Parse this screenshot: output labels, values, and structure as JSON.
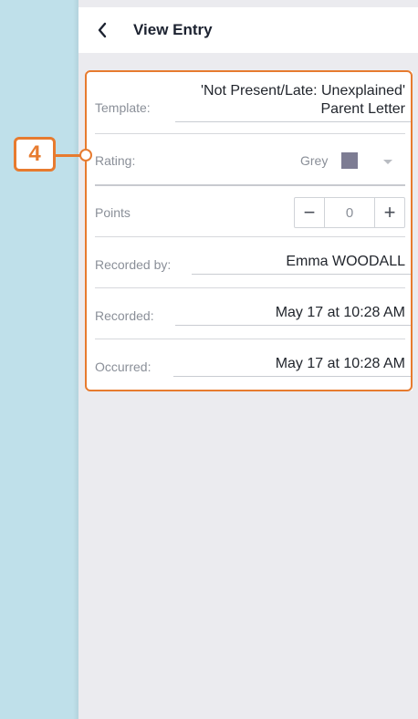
{
  "header": {
    "title": "View Entry",
    "back_icon": "chevron-left-icon"
  },
  "entry": {
    "template": {
      "label": "Template:",
      "value_line1": "'Not Present/Late: Unexplained'",
      "value_line2": "Parent Letter"
    },
    "rating": {
      "label": "Rating:",
      "value": "Grey",
      "swatch_color": "#7d7c93"
    },
    "points": {
      "label": "Points",
      "minus": "−",
      "value": "0",
      "plus": "+"
    },
    "recorded_by": {
      "label": "Recorded by:",
      "value": "Emma WOODALL"
    },
    "recorded": {
      "label": "Recorded:",
      "value": "May 17 at 10:28 AM"
    },
    "occurred": {
      "label": "Occurred:",
      "value": "May 17 at 10:28 AM"
    }
  },
  "annotation": {
    "callout_number": "4",
    "accent_color": "#e77b2f"
  }
}
